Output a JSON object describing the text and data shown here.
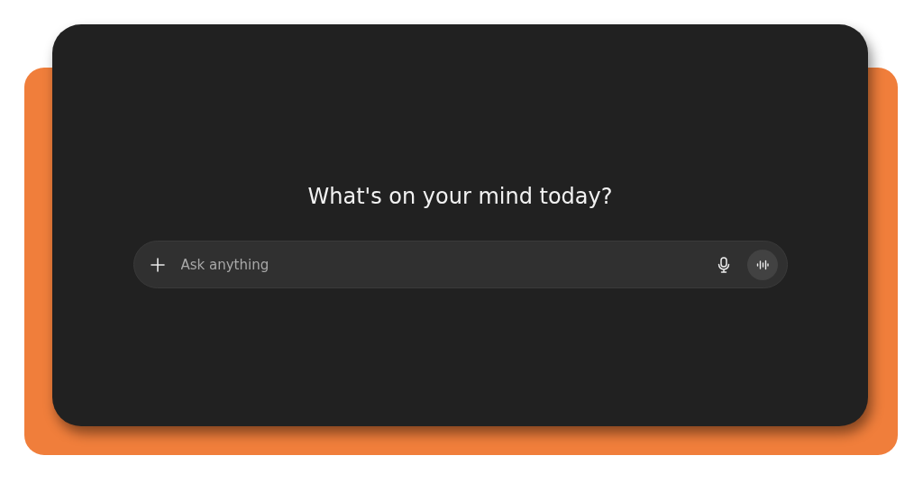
{
  "heading": "What's on your mind today?",
  "composer": {
    "placeholder": "Ask anything"
  }
}
